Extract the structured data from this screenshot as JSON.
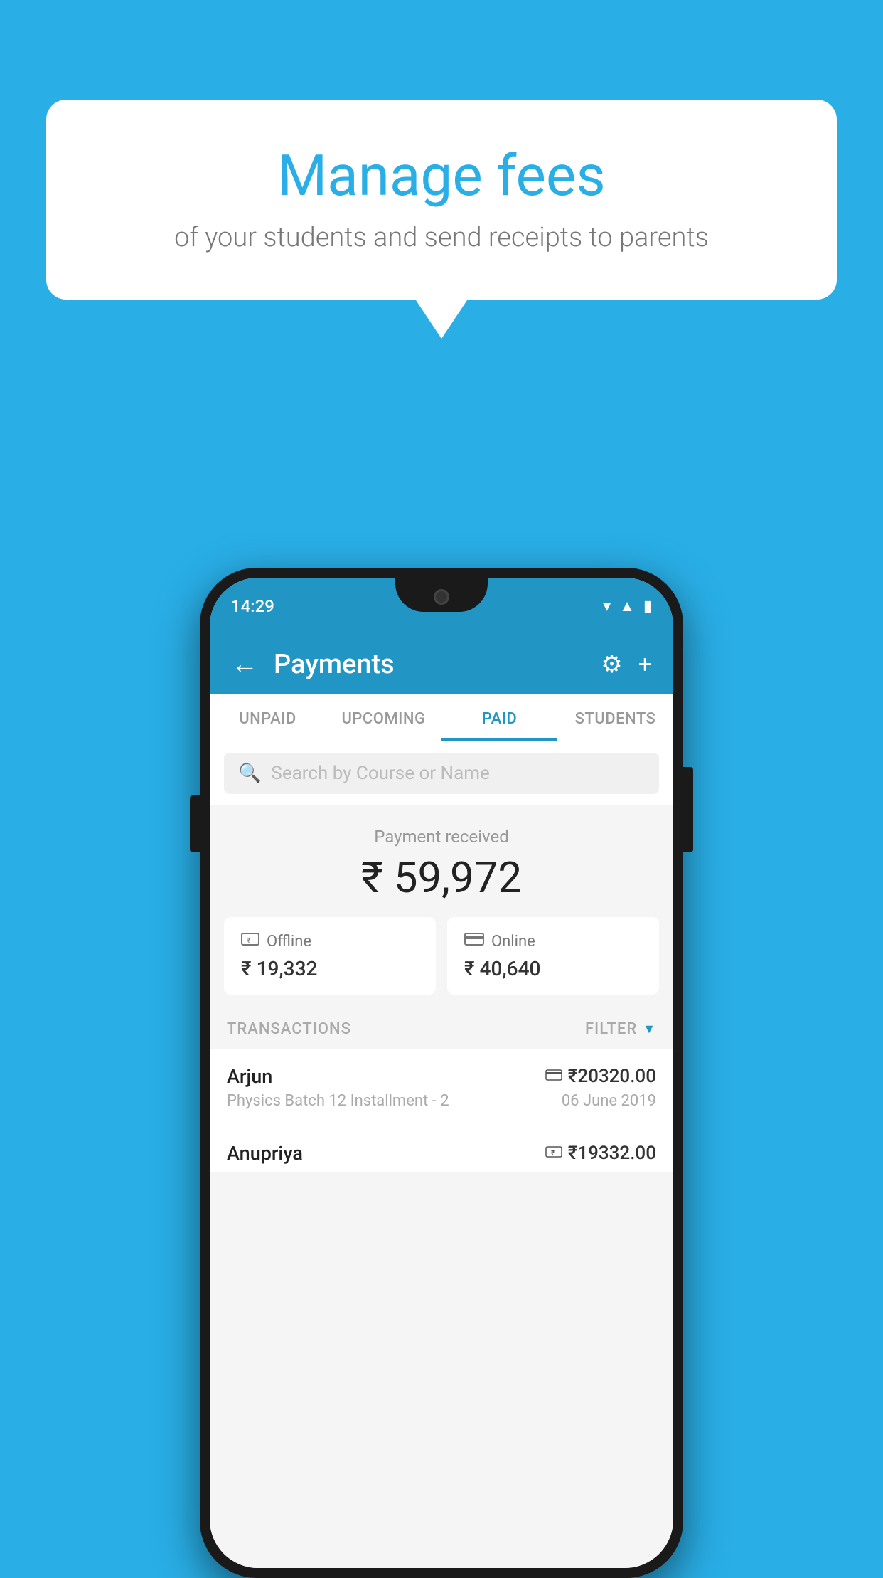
{
  "background_color": "#29aee6",
  "bubble": {
    "title": "Manage fees",
    "subtitle": "of your students and send receipts to parents"
  },
  "status_bar": {
    "time": "14:29",
    "wifi": "▼",
    "signal": "▲",
    "battery": "▮"
  },
  "header": {
    "title": "Payments",
    "back_label": "←",
    "gear_label": "⚙",
    "plus_label": "+"
  },
  "tabs": [
    {
      "label": "UNPAID",
      "active": false
    },
    {
      "label": "UPCOMING",
      "active": false
    },
    {
      "label": "PAID",
      "active": true
    },
    {
      "label": "STUDENTS",
      "active": false
    }
  ],
  "search": {
    "placeholder": "Search by Course or Name"
  },
  "payment_received": {
    "label": "Payment received",
    "amount": "₹ 59,972"
  },
  "cards": [
    {
      "icon": "💳",
      "label": "Offline",
      "amount": "₹ 19,332"
    },
    {
      "icon": "💳",
      "label": "Online",
      "amount": "₹ 40,640"
    }
  ],
  "transactions_label": "TRANSACTIONS",
  "filter_label": "FILTER",
  "transactions": [
    {
      "name": "Arjun",
      "amount": "₹20320.00",
      "payment_type": "card",
      "description": "Physics Batch 12 Installment - 2",
      "date": "06 June 2019"
    },
    {
      "name": "Anupriya",
      "amount": "₹19332.00",
      "payment_type": "cash",
      "description": "",
      "date": ""
    }
  ]
}
